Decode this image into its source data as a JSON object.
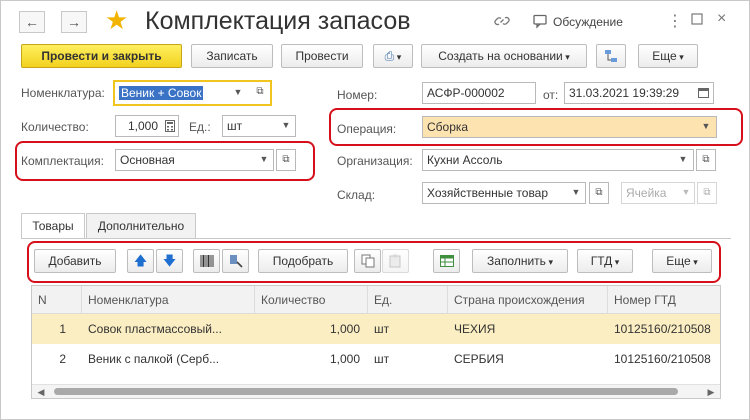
{
  "window": {
    "title": "Комплектация запасов",
    "back_icon": "arrow-left-icon",
    "forward_icon": "arrow-right-icon",
    "favorite_icon": "star-icon",
    "link_icon": "link-icon",
    "discussion_label": "Обсуждение",
    "more_icon": "more-vert-icon",
    "maximize_icon": "maximize-icon",
    "close_icon": "close-icon"
  },
  "toolbar": {
    "post_close_label": "Провести и закрыть",
    "save_label": "Записать",
    "post_label": "Провести",
    "create_based_label": "Создать на основании",
    "more_label": "Еще"
  },
  "form": {
    "nomenclature_label": "Номенклатура:",
    "nomenclature_value": "Веник + Совок",
    "quantity_label": "Количество:",
    "quantity_value": "1,000",
    "unit_label": "Ед.:",
    "unit_value": "шт",
    "kit_label": "Комплектация:",
    "kit_value": "Основная",
    "number_label": "Номер:",
    "number_value": "АСФР-000002",
    "date_label": "от:",
    "date_value": "31.03.2021 19:39:29",
    "operation_label": "Операция:",
    "operation_value": "Сборка",
    "organization_label": "Организация:",
    "organization_value": "Кухни Ассоль",
    "warehouse_label": "Склад:",
    "warehouse_value": "Хозяйственные товар",
    "cell_placeholder": "Ячейка"
  },
  "tabs": [
    {
      "label": "Товары",
      "active": true
    },
    {
      "label": "Дополнительно",
      "active": false
    }
  ],
  "table_toolbar": {
    "add_label": "Добавить",
    "pick_label": "Подобрать",
    "fill_label": "Заполнить",
    "gtd_label": "ГТД",
    "more_label": "Еще"
  },
  "table": {
    "columns": [
      "N",
      "Номенклатура",
      "Количество",
      "Ед.",
      "Страна происхождения",
      "Номер ГТД"
    ],
    "rows": [
      {
        "n": "1",
        "name": "Совок пластмассовый...",
        "qty": "1,000",
        "unit": "шт",
        "country": "ЧЕХИЯ",
        "gtd": "10125160/210508",
        "selected": true
      },
      {
        "n": "2",
        "name": "Веник с палкой (Серб...",
        "qty": "1,000",
        "unit": "шт",
        "country": "СЕРБИЯ",
        "gtd": "10125160/210508",
        "selected": false
      }
    ]
  },
  "colors": {
    "primary_button": "#f2d21e",
    "highlight_frame": "#d6101b",
    "selected_row": "#fbeec2",
    "operation_field": "#fde3b0"
  }
}
